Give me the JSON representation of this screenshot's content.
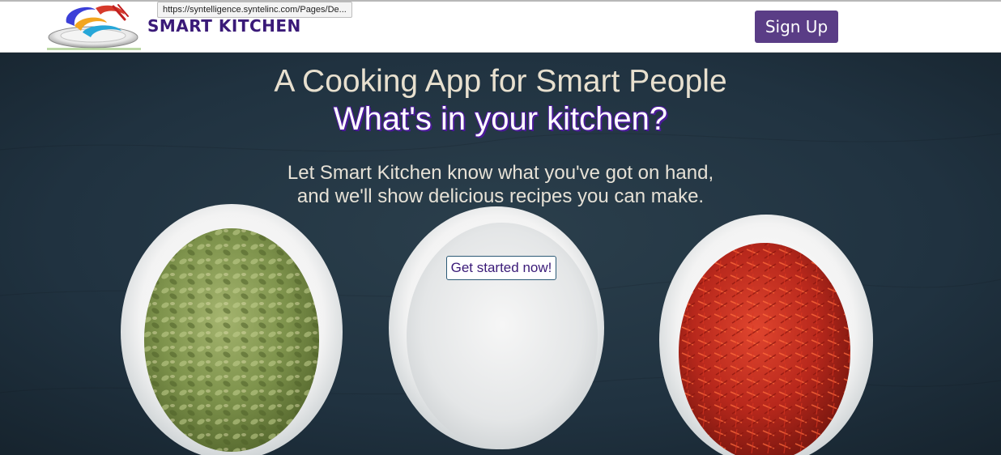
{
  "browser": {
    "status_url": "https://syntelligence.syntelinc.com/Pages/De..."
  },
  "header": {
    "brand_name": "SMART KITCHEN",
    "signup_label": "Sign Up"
  },
  "hero": {
    "title": "A Cooking App for Smart People",
    "subtitle": "What's in your kitchen?",
    "tagline_line1": "Let Smart Kitchen know what you've got on hand,",
    "tagline_line2": "and we'll show delicious recipes you can make.",
    "cta_label": "Get started now!"
  },
  "colors": {
    "brand": "#3a1a78",
    "signup_button": "#5a3d86",
    "hero_background": "#1f2f3a",
    "title_text": "#e8e0cf"
  },
  "icons": {
    "logo": "smart-kitchen-logo-icon"
  }
}
